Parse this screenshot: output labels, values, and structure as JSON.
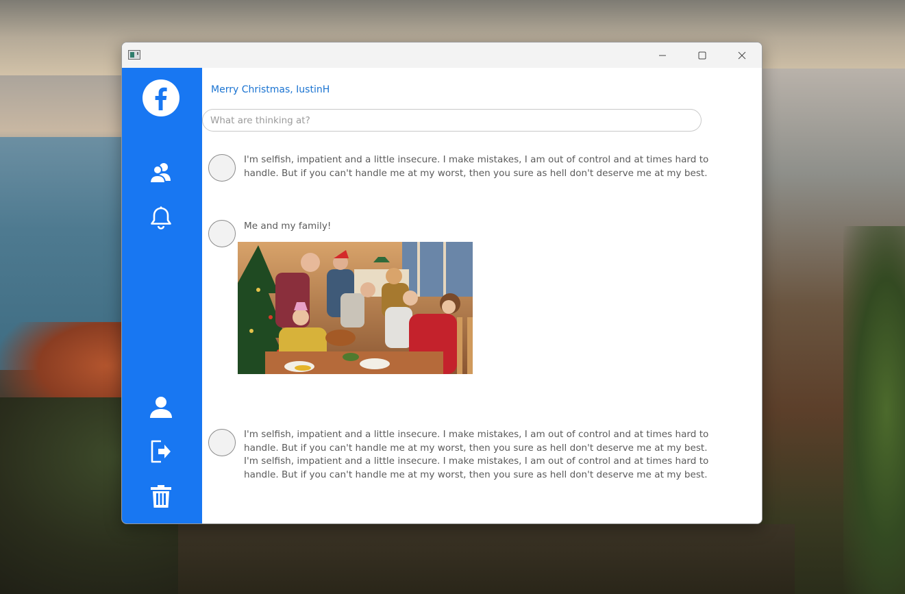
{
  "window": {
    "buttons": {
      "minimize": "minimize-icon",
      "maximize": "maximize-icon",
      "close": "close-icon"
    }
  },
  "sidebar": {
    "items": [
      {
        "icon": "facebook-logo-icon"
      },
      {
        "icon": "friends-icon"
      },
      {
        "icon": "bell-icon"
      },
      {
        "icon": "profile-icon"
      },
      {
        "icon": "logout-icon"
      },
      {
        "icon": "trash-icon"
      }
    ],
    "accent": "#1877f2"
  },
  "main": {
    "greeting": "Merry Christmas, IustinH",
    "status_placeholder": "What are thinking at?",
    "posts": [
      {
        "text": "I'm selfish, impatient and a little insecure. I make mistakes, I am out of control and at times hard to handle. But if you can't handle me at my worst, then you sure as hell don't deserve me at my best."
      },
      {
        "text": "Me and my family!",
        "image": "family-christmas-dinner-photo"
      },
      {
        "text": "I'm selfish, impatient and a little insecure. I make mistakes, I am out of control and at times hard to handle. But if you can't handle me at my worst, then you sure as hell don't deserve me at my best.  I'm selfish, impatient and a little insecure. I make mistakes, I am out of control and at times hard to handle. But if you can't handle me at my worst, then you sure as hell don't deserve me at my best."
      }
    ]
  }
}
